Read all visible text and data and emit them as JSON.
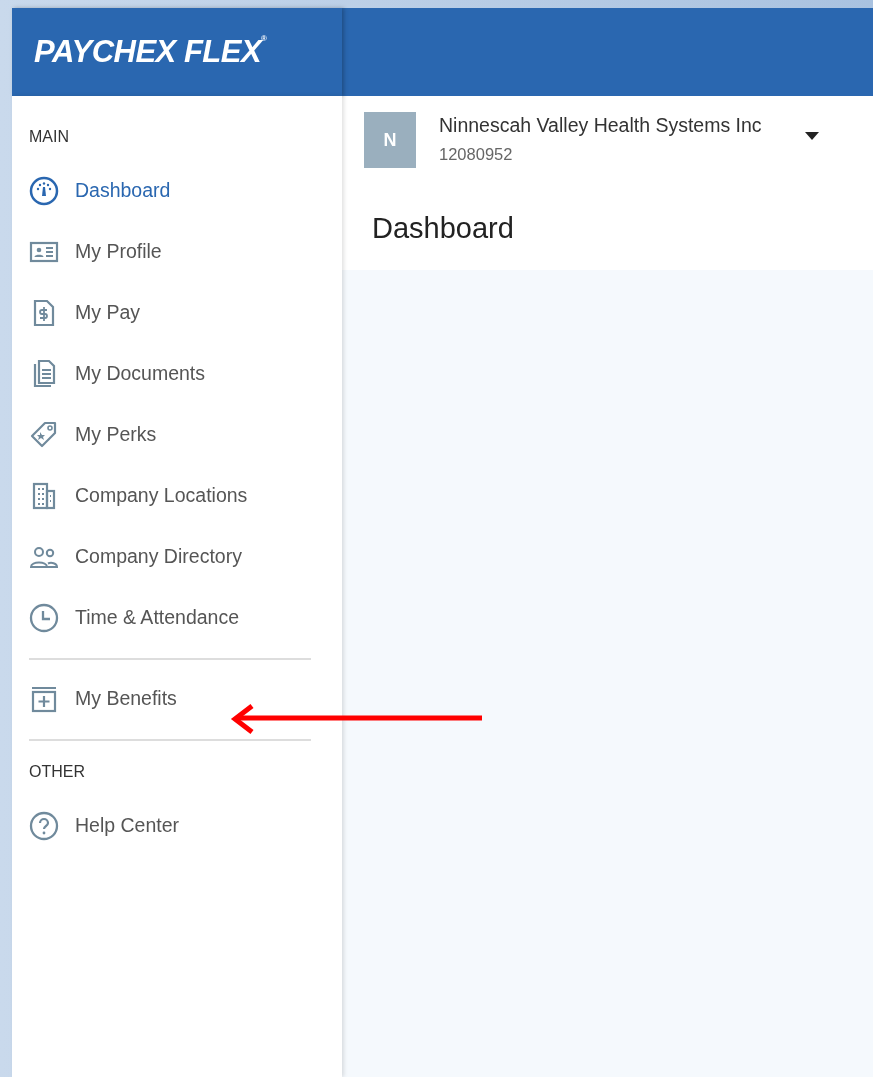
{
  "header": {
    "logo": "PAYCHEX FLEX$^{®}$"
  },
  "sidebar": {
    "sections": [
      {
        "heading": "MAIN",
        "items": [
          {
            "label": "Dashboard",
            "selected": true
          },
          {
            "label": "My Profile",
            "selected": false
          },
          {
            "label": "My Pay",
            "selected": false
          },
          {
            "label": "My Documents",
            "selected": false
          },
          {
            "label": "My Perks",
            "selected": false
          },
          {
            "label": "Company Locations",
            "selected": false
          },
          {
            "label": "Company Directory",
            "selected": false
          },
          {
            "label": "Time & Attendance",
            "selected": false
          }
        ]
      },
      {
        "items": [
          {
            "label": "My Benefits",
            "selected": false
          }
        ]
      },
      {
        "heading": "OTHER",
        "items": [
          {
            "label": "Help Center",
            "selected": false
          }
        ]
      }
    ]
  },
  "company": {
    "avatar": "N",
    "name": "Ninnescah Valley Health Systems Inc",
    "number": "12080952"
  },
  "page_title": "Dashboard",
  "annotations": [
    {
      "kind": "arrow"
    }
  ]
}
